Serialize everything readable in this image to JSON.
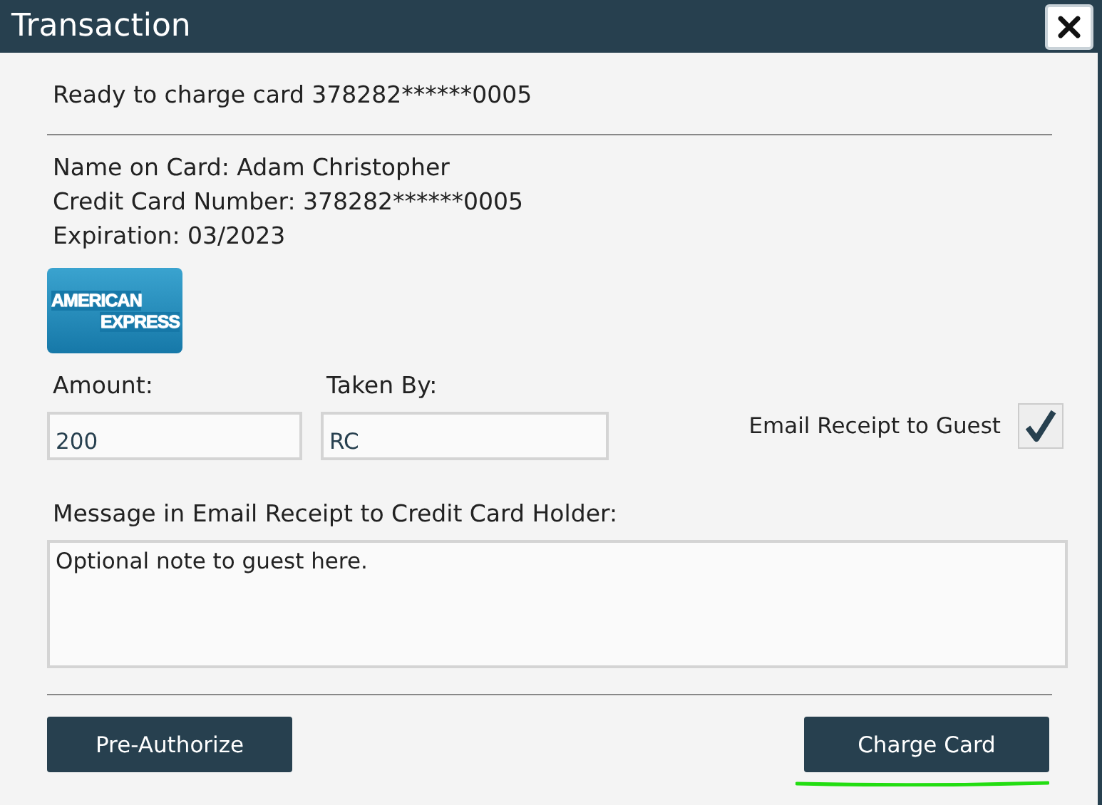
{
  "window": {
    "title": "Transaction"
  },
  "status_message": "Ready to charge card 378282******0005",
  "card_details": [
    "Name on Card: Adam Christopher",
    "Credit Card Number: 378282******0005",
    "Expiration: 03/2023"
  ],
  "card_logo": {
    "lines": [
      "AMERICAN",
      "EXPRESS"
    ]
  },
  "fields": [
    {
      "label": "Amount:",
      "value": "200"
    },
    {
      "label": "Taken By:",
      "value": "RC"
    }
  ],
  "email_receipt": {
    "label": "Email Receipt to Guest",
    "checked": true
  },
  "message": {
    "label": "Message in Email Receipt to Credit Card Holder:",
    "value": "Optional note to guest here."
  },
  "buttons": [
    {
      "label": "Pre-Authorize",
      "highlighted": false
    },
    {
      "label": "Charge Card",
      "highlighted": true
    }
  ]
}
